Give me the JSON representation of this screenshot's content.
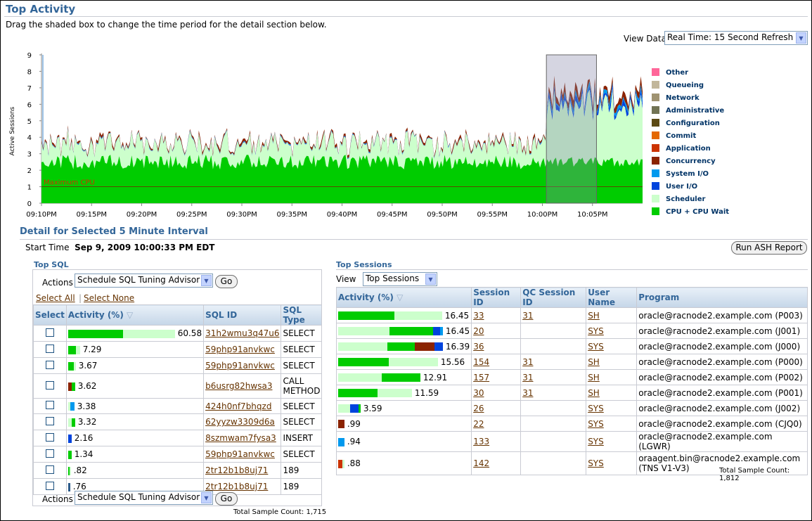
{
  "page": {
    "title": "Top Activity",
    "instructions": "Drag the shaded box to change the time period for the detail section below.",
    "view_data_label": "View Data",
    "view_data_value": "Real Time: 15 Second Refresh"
  },
  "colors": {
    "cpu": "#00cc00",
    "scheduler": "#ccffcc",
    "user_io": "#0044dd",
    "system_io": "#0099ee",
    "concurrency": "#8b2300",
    "application": "#cc3300",
    "commit": "#e46800",
    "configuration": "#5c4a14",
    "administrative": "#717354",
    "network": "#9f9371",
    "queueing": "#c2b79b",
    "other": "#ff6699",
    "title": "#336699",
    "link": "#663300"
  },
  "chart_data": {
    "type": "area",
    "ylabel": "Active Sessions",
    "ylim": [
      0,
      9
    ],
    "yticks": [
      "0",
      "1",
      "2",
      "3",
      "4",
      "5",
      "6",
      "7",
      "8",
      "9"
    ],
    "xticks": [
      "09:10PM",
      "09:15PM",
      "09:20PM",
      "09:25PM",
      "09:30PM",
      "09:35PM",
      "09:40PM",
      "09:45PM",
      "09:50PM",
      "09:55PM",
      "10:00PM",
      "10:05PM"
    ],
    "max_cpu_label": "Maximum CPU",
    "max_cpu_value": 1,
    "selection_start_minute": 50.4,
    "selection_end_minute": 55.4,
    "minute_range": [
      0,
      60
    ],
    "stack": [
      {
        "name": "CPU + CPU Wait",
        "color": "#00cc00",
        "base_before": 2.5,
        "base_after": 2.5
      },
      {
        "name": "Scheduler",
        "color": "#ccffcc",
        "base_before": 0.9,
        "base_after": 3.0
      },
      {
        "name": "User I/O",
        "color": "#0044dd",
        "base_before": 0.02,
        "base_after": 0.2
      },
      {
        "name": "System I/O",
        "color": "#0099ee",
        "base_before": 0.02,
        "base_after": 0.15
      },
      {
        "name": "Concurrency",
        "color": "#8b2300",
        "base_before": 0.1,
        "base_after": 0.3
      }
    ],
    "legend": [
      {
        "name": "Other",
        "color": "#ff6699"
      },
      {
        "name": "Queueing",
        "color": "#c2b79b"
      },
      {
        "name": "Network",
        "color": "#9f9371"
      },
      {
        "name": "Administrative",
        "color": "#717354"
      },
      {
        "name": "Configuration",
        "color": "#5c4a14"
      },
      {
        "name": "Commit",
        "color": "#e46800"
      },
      {
        "name": "Application",
        "color": "#cc3300"
      },
      {
        "name": "Concurrency",
        "color": "#8b2300"
      },
      {
        "name": "System I/O",
        "color": "#0099ee"
      },
      {
        "name": "User I/O",
        "color": "#0044dd"
      },
      {
        "name": "Scheduler",
        "color": "#ccffcc"
      },
      {
        "name": "CPU + CPU Wait",
        "color": "#00cc00"
      }
    ]
  },
  "detail": {
    "title": "Detail for Selected 5 Minute Interval",
    "start_time_label": "Start Time",
    "start_time_value": "Sep 9, 2009 10:00:33 PM EDT",
    "run_ash_button": "Run ASH Report"
  },
  "top_sql": {
    "title": "Top SQL",
    "actions_label": "Actions",
    "actions_value": "Schedule SQL Tuning Advisor",
    "go_button": "Go",
    "select_all": "Select All",
    "select_none": "Select None",
    "headers": {
      "select": "Select",
      "activity": "Activity (%)",
      "sql_id": "SQL ID",
      "sql_type": "SQL Type"
    },
    "rows": [
      {
        "activity": "60.58",
        "pct": 60.58,
        "sql_id": "31h2wmu3q47u6",
        "sql_type": "SELECT",
        "segments": [
          {
            "c": "#00cc00",
            "v": 50
          },
          {
            "c": "#ccffcc",
            "v": 48
          }
        ]
      },
      {
        "activity": "7.29",
        "pct": 7.29,
        "sql_id": "59php91anvkwc",
        "sql_type": "SELECT",
        "segments": [
          {
            "c": "#00cc00",
            "v": 7
          },
          {
            "c": "#ccffcc",
            "v": 4
          }
        ]
      },
      {
        "activity": "3.67",
        "pct": 3.67,
        "sql_id": "59php91anvkwc",
        "sql_type": "SELECT",
        "segments": [
          {
            "c": "#00cc00",
            "v": 5
          },
          {
            "c": "#ccffcc",
            "v": 2
          }
        ]
      },
      {
        "activity": "3.62",
        "pct": 3.62,
        "sql_id": "b6usrg82hwsa3",
        "sql_type": "CALL METHOD",
        "segments": [
          {
            "c": "#8b2300",
            "v": 3
          },
          {
            "c": "#00cc00",
            "v": 3
          }
        ]
      },
      {
        "activity": "3.38",
        "pct": 3.38,
        "sql_id": "424h0nf7bhqzd",
        "sql_type": "SELECT",
        "segments": [
          {
            "c": "#ccffcc",
            "v": 2
          },
          {
            "c": "#0099ee",
            "v": 4
          }
        ]
      },
      {
        "activity": "3.32",
        "pct": 3.32,
        "sql_id": "62yyzw3309d6a",
        "sql_type": "SELECT",
        "segments": [
          {
            "c": "#ccffcc",
            "v": 3
          },
          {
            "c": "#00cc00",
            "v": 3
          }
        ]
      },
      {
        "activity": "2.16",
        "pct": 2.16,
        "sql_id": "8szmwam7fysa3",
        "sql_type": "INSERT",
        "segments": [
          {
            "c": "#0044dd",
            "v": 3
          }
        ]
      },
      {
        "activity": "1.34",
        "pct": 1.34,
        "sql_id": "59php91anvkwc",
        "sql_type": "SELECT",
        "segments": [
          {
            "c": "#00cc00",
            "v": 3
          }
        ]
      },
      {
        "activity": ".82",
        "pct": 0.82,
        "sql_id": "2tr12b1b8uj71",
        "sql_type": "189",
        "segments": [
          {
            "c": "#00cc00",
            "v": 1
          },
          {
            "c": "#ccffcc",
            "v": 1
          }
        ]
      },
      {
        "activity": ".76",
        "pct": 0.76,
        "sql_id": "2tr12b1b8uj71",
        "sql_type": "189",
        "segments": [
          {
            "c": "#2b5b8a",
            "v": 2
          }
        ]
      }
    ],
    "total": "Total Sample Count: 1,715"
  },
  "top_sessions": {
    "title": "Top Sessions",
    "view_label": "View",
    "view_value": "Top Sessions",
    "headers": {
      "activity": "Activity (%)",
      "session_id": "Session ID",
      "qc_session_id": "QC Session ID",
      "user_name": "User Name",
      "program": "Program"
    },
    "rows": [
      {
        "activity": "16.45",
        "session_id": "33",
        "qc_session_id": "31",
        "user_name": "SH",
        "program": "oracle@racnode2.example.com (P003)",
        "segments": [
          {
            "c": "#00cc00",
            "v": 80
          },
          {
            "c": "#ccffcc",
            "v": 68
          }
        ]
      },
      {
        "activity": "16.45",
        "session_id": "20",
        "qc_session_id": "",
        "user_name": "SYS",
        "program": "oracle@racnode2.example.com (J001)",
        "segments": [
          {
            "c": "#ccffcc",
            "v": 73
          },
          {
            "c": "#00cc00",
            "v": 62
          },
          {
            "c": "#0044dd",
            "v": 10
          },
          {
            "c": "#0099ee",
            "v": 4
          }
        ]
      },
      {
        "activity": "16.39",
        "session_id": "36",
        "qc_session_id": "",
        "user_name": "SYS",
        "program": "oracle@racnode2.example.com (J000)",
        "segments": [
          {
            "c": "#ccffcc",
            "v": 70
          },
          {
            "c": "#00cc00",
            "v": 39
          },
          {
            "c": "#8b2300",
            "v": 28
          },
          {
            "c": "#0044dd",
            "v": 12
          }
        ]
      },
      {
        "activity": "15.56",
        "session_id": "154",
        "qc_session_id": "31",
        "user_name": "SH",
        "program": "oracle@racnode2.example.com (P000)",
        "segments": [
          {
            "c": "#00cc00",
            "v": 72
          },
          {
            "c": "#ccffcc",
            "v": 70
          }
        ]
      },
      {
        "activity": "12.91",
        "session_id": "157",
        "qc_session_id": "31",
        "user_name": "SH",
        "program": "oracle@racnode2.example.com (P002)",
        "segments": [
          {
            "c": "#ccffcc",
            "v": 62
          },
          {
            "c": "#00cc00",
            "v": 55
          }
        ]
      },
      {
        "activity": "11.59",
        "session_id": "30",
        "qc_session_id": "31",
        "user_name": "SH",
        "program": "oracle@racnode2.example.com (P001)",
        "segments": [
          {
            "c": "#00cc00",
            "v": 56
          },
          {
            "c": "#ccffcc",
            "v": 49
          }
        ]
      },
      {
        "activity": "3.59",
        "session_id": "26",
        "qc_session_id": "",
        "user_name": "SYS",
        "program": "oracle@racnode2.example.com (J002)",
        "segments": [
          {
            "c": "#ccffcc",
            "v": 17
          },
          {
            "c": "#0044dd",
            "v": 12
          },
          {
            "c": "#00cc00",
            "v": 3
          }
        ]
      },
      {
        "activity": ".99",
        "session_id": "22",
        "qc_session_id": "",
        "user_name": "SYS",
        "program": "oracle@racnode2.example.com (CJQ0)",
        "segments": [
          {
            "c": "#8b2300",
            "v": 9
          }
        ]
      },
      {
        "activity": ".94",
        "session_id": "133",
        "qc_session_id": "",
        "user_name": "SYS",
        "program": "oracle@racnode2.example.com (LGWR)",
        "segments": [
          {
            "c": "#0099ee",
            "v": 9
          }
        ]
      },
      {
        "activity": ".88",
        "session_id": "142",
        "qc_session_id": "",
        "user_name": "SYS",
        "program": "oraagent.bin@racnode2.example.com (TNS V1-V3)",
        "segments": [
          {
            "c": "#cc3300",
            "v": 6
          },
          {
            "c": "#ccffcc",
            "v": 3
          }
        ]
      }
    ],
    "total": "Total Sample Count: 1,812"
  }
}
